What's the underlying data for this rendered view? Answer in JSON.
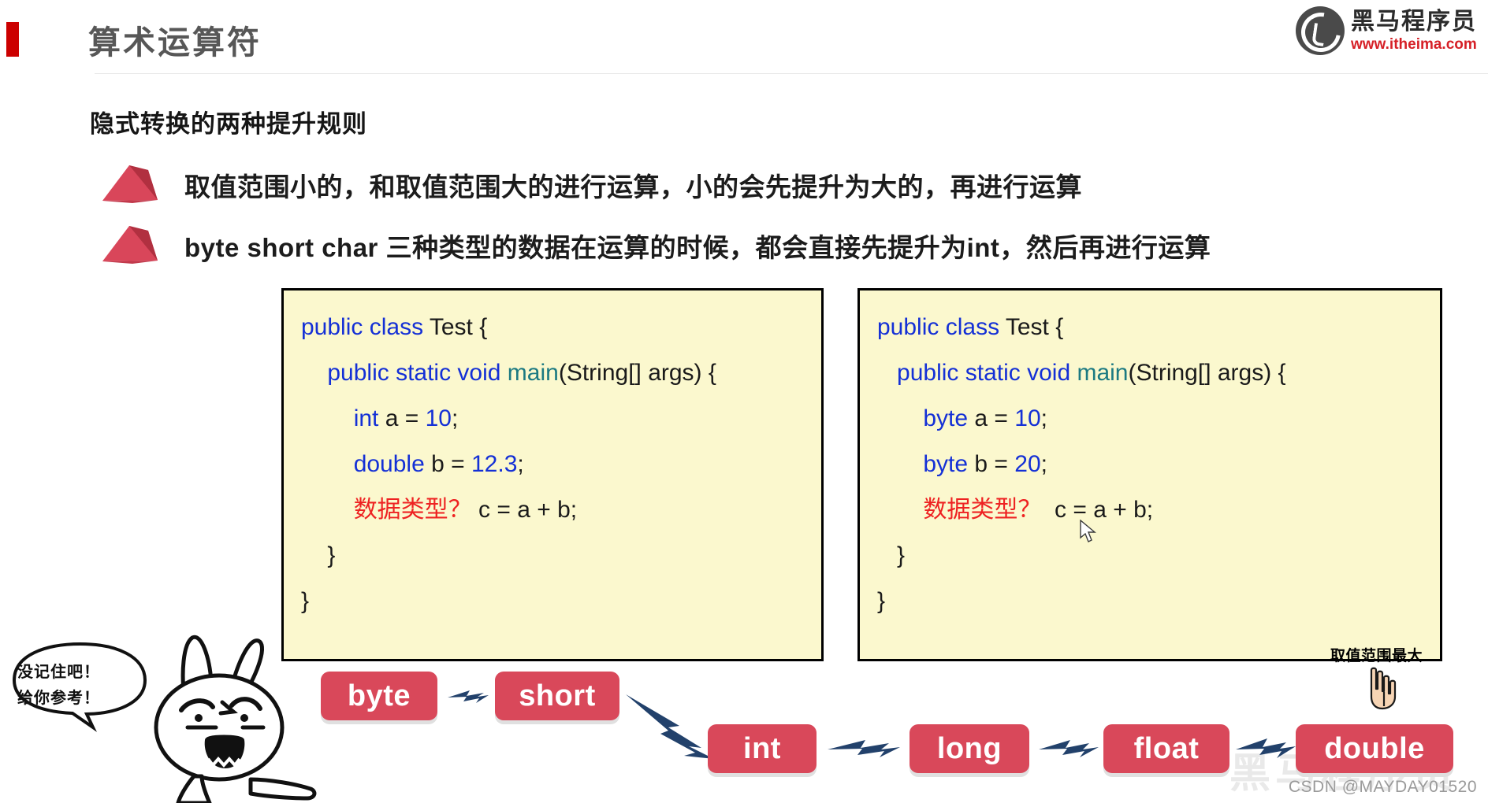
{
  "header": {
    "title": "算术运算符",
    "logo_name": "黑马程序员",
    "logo_url": "www.itheima.com"
  },
  "subtitle": "隐式转换的两种提升规则",
  "bullets": [
    {
      "text": "取值范围小的，和取值范围大的进行运算，小的会先提升为大的，再进行运算"
    },
    {
      "text": "byte short char 三种类型的数据在运算的时候，都会直接先提升为int，然后再进行运算"
    }
  ],
  "code_left": {
    "lines": [
      [
        {
          "t": "public class ",
          "c": "kw"
        },
        {
          "t": "Test {",
          "c": ""
        }
      ],
      [
        {
          "t": "    ",
          "c": ""
        },
        {
          "t": "public static void ",
          "c": "kw"
        },
        {
          "t": "main",
          "c": "mth"
        },
        {
          "t": "(String[] args) {",
          "c": ""
        }
      ],
      [
        {
          "t": "        ",
          "c": ""
        },
        {
          "t": "int ",
          "c": "kw"
        },
        {
          "t": "a = ",
          "c": ""
        },
        {
          "t": "10",
          "c": "num"
        },
        {
          "t": ";",
          "c": ""
        }
      ],
      [
        {
          "t": "        ",
          "c": ""
        },
        {
          "t": "double ",
          "c": "kw"
        },
        {
          "t": "b = ",
          "c": ""
        },
        {
          "t": "12.3",
          "c": "num"
        },
        {
          "t": ";",
          "c": ""
        }
      ],
      [
        {
          "t": "        ",
          "c": ""
        },
        {
          "t": "数据类型？",
          "c": "red"
        },
        {
          "t": " c = a + b;",
          "c": ""
        }
      ],
      [
        {
          "t": "    }",
          "c": ""
        }
      ],
      [
        {
          "t": "}",
          "c": ""
        }
      ]
    ]
  },
  "code_right": {
    "lines": [
      [
        {
          "t": "public class ",
          "c": "kw"
        },
        {
          "t": "Test {",
          "c": ""
        }
      ],
      [
        {
          "t": "   ",
          "c": ""
        },
        {
          "t": "public static void ",
          "c": "kw"
        },
        {
          "t": "main",
          "c": "mth"
        },
        {
          "t": "(String[] args) {",
          "c": ""
        }
      ],
      [
        {
          "t": "       ",
          "c": ""
        },
        {
          "t": "byte ",
          "c": "kw"
        },
        {
          "t": "a = ",
          "c": ""
        },
        {
          "t": "10",
          "c": "num"
        },
        {
          "t": ";",
          "c": ""
        }
      ],
      [
        {
          "t": "       ",
          "c": ""
        },
        {
          "t": "byte ",
          "c": "kw"
        },
        {
          "t": "b = ",
          "c": ""
        },
        {
          "t": "20",
          "c": "num"
        },
        {
          "t": ";",
          "c": ""
        }
      ],
      [
        {
          "t": "       ",
          "c": ""
        },
        {
          "t": "数据类型？",
          "c": "red"
        },
        {
          "t": "  c = a + b;",
          "c": ""
        }
      ],
      [
        {
          "t": "   }",
          "c": ""
        }
      ],
      [
        {
          "t": "}",
          "c": ""
        }
      ]
    ],
    "range_label": "取值范围最大"
  },
  "type_chain": {
    "chips": [
      "byte",
      "short",
      "int",
      "long",
      "float",
      "double"
    ],
    "chip_color": "#d9485a",
    "arrow_color": "#22416b"
  },
  "mascot": {
    "bubble_line_1": "没记住吧！",
    "bubble_line_2": "给你参考！"
  },
  "watermark": {
    "big": "黑马程序员",
    "csdn": "CSDN @MAYDAY01520"
  },
  "colors": {
    "title": "#575757",
    "marker_red": "#cc0000",
    "code_bg": "#FBF8CE",
    "keyword_blue": "#1430d6",
    "method_teal": "#1c7a82",
    "red_text": "#ee2222"
  }
}
